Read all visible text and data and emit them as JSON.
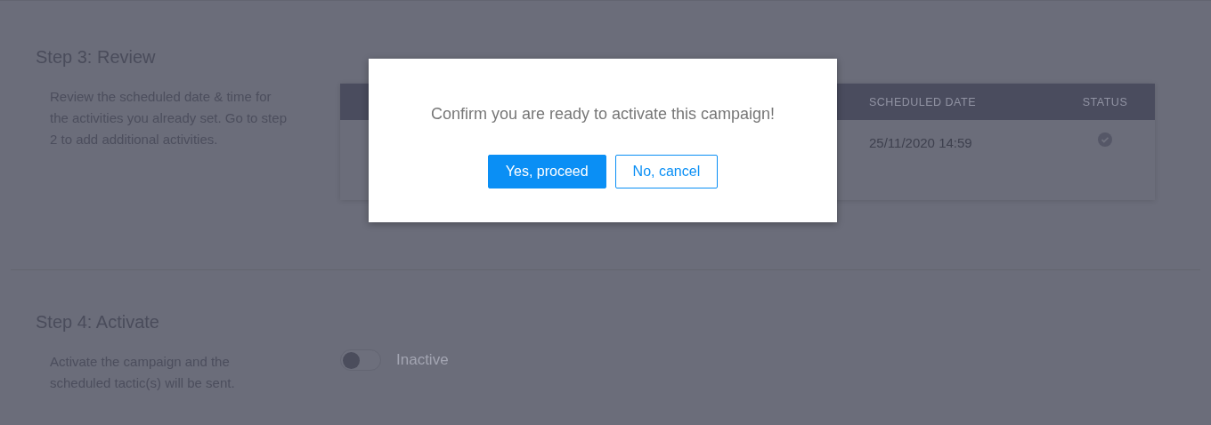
{
  "steps": [
    {
      "kind": "review",
      "title": "Step 3: Review",
      "description": "Review the scheduled date & time for the activities you already set. Go to step 2 to add additional activities.",
      "table": {
        "columns": [
          "SCHEDULED DATE",
          "STATUS"
        ],
        "rows": [
          {
            "scheduled_date": "25/11/2020 14:59",
            "done": true
          }
        ]
      }
    },
    {
      "kind": "activate",
      "title": "Step 4: Activate",
      "description": "Activate the campaign and the scheduled tactic(s) will be sent.",
      "toggle": {
        "on": false,
        "label": "Inactive"
      }
    }
  ],
  "dialog": {
    "message": "Confirm you are ready to activate this campaign!",
    "buttons": [
      {
        "label": "Yes, proceed",
        "kind": "primary"
      },
      {
        "label": "No, cancel",
        "kind": "secondary"
      }
    ]
  }
}
